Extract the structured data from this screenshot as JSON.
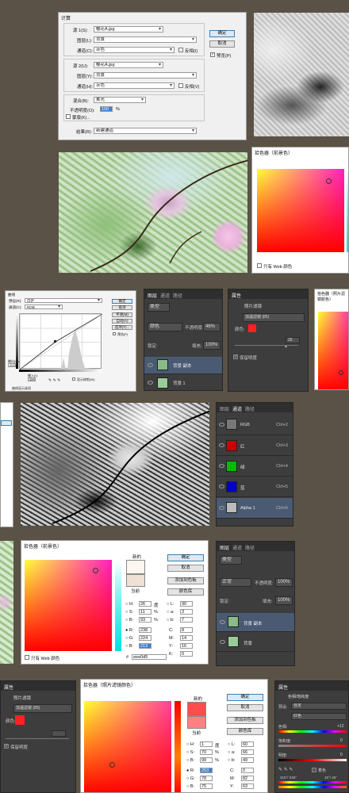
{
  "calc": {
    "title": "计算",
    "src1_label": "源 1(S):",
    "src1_value": "樱花A.jpg",
    "layer1_label": "图层(L):",
    "layer1_value": "背景",
    "ch1_label": "通道(C):",
    "ch1_value": "灰色",
    "invert1": "反相(I)",
    "src2_label": "源 2(U):",
    "src2_value": "樱花A.jpg",
    "layer2_label": "图层(Y):",
    "layer2_value": "背景",
    "ch2_label": "通道(H):",
    "ch2_value": "灰色",
    "invert2": "反相(V)",
    "blend_label": "混合(B):",
    "blend_value": "柔光",
    "opacity_label": "不透明度(O):",
    "opacity_value": "100",
    "percent": "%",
    "mask_label": "蒙版(K)...",
    "result_label": "结果(R):",
    "result_value": "新建通道",
    "ok": "确定",
    "cancel": "取消",
    "preview": "预览(P)"
  },
  "picker1": {
    "title": "拾色器（前景色）",
    "web_only": "只有 Web 颜色"
  },
  "curves": {
    "title": "曲线",
    "preset_label": "预设(R):",
    "preset_value": "自定",
    "channel_label": "通道(C):",
    "channel_value": "RGB",
    "ok": "确定",
    "cancel": "取消",
    "smooth": "平滑(M)",
    "auto": "自动(A)",
    "options": "选项(T)...",
    "preview": "预览(P)",
    "output_label": "输出(O):",
    "output_value": "204",
    "input_label": "输入(I):",
    "input_value": "124",
    "show_clip": "显示修剪(W)",
    "curve_display": "曲线显示选项"
  },
  "layers1": {
    "tabs": [
      "图层",
      "通道",
      "路径"
    ],
    "kind": "类型",
    "blend": "颜色",
    "opacity_label": "不透明度:",
    "opacity_value": "46%",
    "lock_label": "锁定:",
    "fill_label": "填充:",
    "fill_value": "100%",
    "layers": [
      "背景 副本",
      "背景 1"
    ]
  },
  "props": {
    "tabs": [
      "属性"
    ],
    "title": "照片滤镜",
    "filter_label": "滤镜:",
    "filter_value": "加温滤镜 (85)",
    "color_label": "颜色:",
    "density_label": "浓度:",
    "density_value": "25",
    "preserve": "保留明度"
  },
  "picker_photo": {
    "title": "拾色器（照片滤镜颜色）"
  },
  "channels": {
    "tabs": [
      "图层",
      "通道",
      "路径"
    ],
    "rows": [
      {
        "name": "RGB",
        "key": "Ctrl+2"
      },
      {
        "name": "红",
        "key": "Ctrl+3"
      },
      {
        "name": "绿",
        "key": "Ctrl+4"
      },
      {
        "name": "蓝",
        "key": "Ctrl+5"
      },
      {
        "name": "Alpha 1",
        "key": "Ctrl+6"
      }
    ]
  },
  "picker2": {
    "title": "拾色器（前景色）",
    "new_label": "新的",
    "current_label": "当前",
    "ok": "确定",
    "cancel": "取消",
    "add_swatch": "添加到色板",
    "libraries": "颜色库",
    "H": "26",
    "S": "11",
    "B": "93",
    "R": "238",
    "G": "224",
    "Bv": "213",
    "L": "90",
    "a": "3",
    "b": "7",
    "C": "8",
    "M": "14",
    "Y": "16",
    "K": "0",
    "deg": "度",
    "hex": "eee0d5",
    "web_only": "只有 Web 颜色"
  },
  "layers2": {
    "tabs": [
      "图层",
      "通道",
      "路径"
    ],
    "kind": "类型",
    "blend": "正常",
    "opacity_label": "不透明度:",
    "opacity_value": "100%",
    "lock_label": "锁定:",
    "fill_label": "填充:",
    "fill_value": "100%",
    "layers": [
      "背景 副本",
      "背景"
    ]
  },
  "props2": {
    "tabs": [
      "属性"
    ],
    "title": "照片滤镜",
    "filter_value": "加温滤镜 (85)",
    "color_label": "颜色:",
    "density_label": "浓度:",
    "density_value": "",
    "preserve": "保留明度"
  },
  "picker3": {
    "title": "拾色器（照片滤镜颜色）",
    "new_label": "新的",
    "current_label": "当前",
    "ok": "确定",
    "cancel": "取消",
    "add_swatch": "添加到色板",
    "libraries": "颜色库",
    "H": "1",
    "S": "70",
    "B": "99",
    "R": "253",
    "G": "78",
    "Bv": "75",
    "L": "60",
    "a": "66",
    "b": "49",
    "C": "0",
    "M": "82",
    "Y": "63",
    "K": "0",
    "deg": "度"
  },
  "huesat": {
    "tab": "属性",
    "title": "色相/饱和度",
    "preset_label": "预设:",
    "preset_value": "自定",
    "range": "红色",
    "hue_label": "色相:",
    "hue_value": "+12",
    "sat_label": "饱和度:",
    "sat_value": "0",
    "light_label": "明度:",
    "light_value": "0",
    "colorize": "着色",
    "range_text": "315°/ 345°",
    "range_text2": "15°\\ 45°"
  },
  "colors": {
    "bg": "#5a5246",
    "red": "#ff2020",
    "accent": "#3c7fb1"
  }
}
